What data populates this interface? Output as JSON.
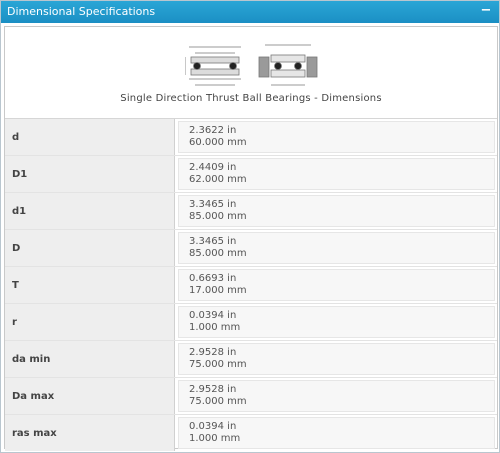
{
  "panel": {
    "title": "Dimensional Specifications",
    "collapse_label": "−"
  },
  "figure": {
    "caption": "Single Direction Thrust Ball Bearings - Dimensions"
  },
  "rows": [
    {
      "label": "d",
      "in": "2.3622 in",
      "mm": "60.000 mm"
    },
    {
      "label": "D1",
      "in": "2.4409 in",
      "mm": "62.000 mm"
    },
    {
      "label": "d1",
      "in": "3.3465 in",
      "mm": "85.000 mm"
    },
    {
      "label": "D",
      "in": "3.3465 in",
      "mm": "85.000 mm"
    },
    {
      "label": "T",
      "in": "0.6693 in",
      "mm": "17.000 mm"
    },
    {
      "label": "r",
      "in": "0.0394 in",
      "mm": "1.000 mm"
    },
    {
      "label": "da min",
      "in": "2.9528 in",
      "mm": "75.000 mm"
    },
    {
      "label": "Da max",
      "in": "2.9528 in",
      "mm": "75.000 mm"
    },
    {
      "label": "ras max",
      "in": "0.0394 in",
      "mm": "1.000 mm"
    }
  ]
}
